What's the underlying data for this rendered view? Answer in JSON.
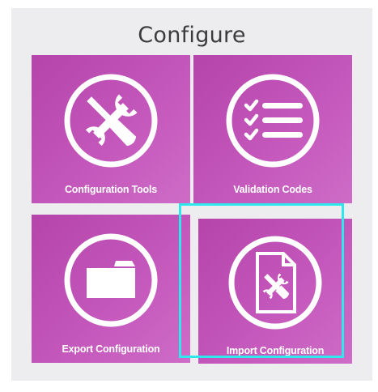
{
  "page": {
    "title": "Configure"
  },
  "tiles": [
    {
      "label": "Configuration Tools",
      "icon": "wrench-screwdriver-icon"
    },
    {
      "label": "Validation Codes",
      "icon": "checklist-icon"
    },
    {
      "label": "Export Configuration",
      "icon": "folder-icon"
    },
    {
      "label": "Import Configuration",
      "icon": "document-tools-icon",
      "selected": true
    }
  ],
  "colors": {
    "tile": "#c04fb6",
    "focus": "#2ee8ee",
    "background": "#ededf0"
  }
}
